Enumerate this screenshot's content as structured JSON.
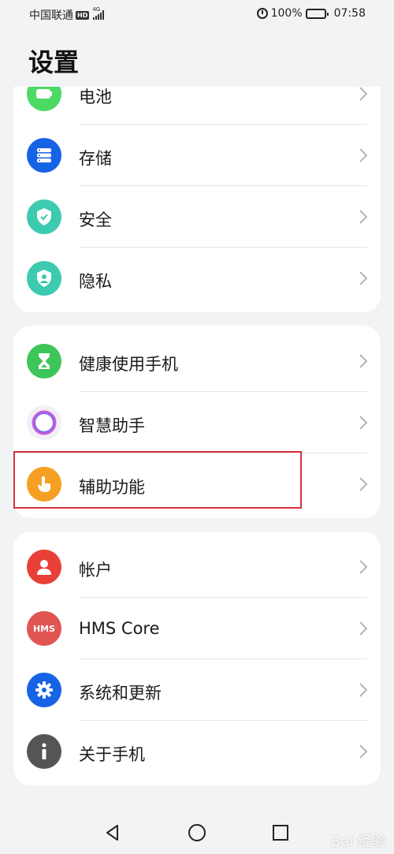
{
  "status_bar": {
    "carrier": "中国联通",
    "hd_badge": "HD",
    "network": "4G",
    "battery_percent": "100%",
    "time": "07:58"
  },
  "page_title": "设置",
  "groups": [
    {
      "items": [
        {
          "label": "电池",
          "icon": "battery-icon",
          "color": "#4cd964"
        },
        {
          "label": "存储",
          "icon": "storage-icon",
          "color": "#1763e6"
        },
        {
          "label": "安全",
          "icon": "shield-icon",
          "color": "#3ccab0"
        },
        {
          "label": "隐私",
          "icon": "privacy-icon",
          "color": "#3ccab0"
        }
      ]
    },
    {
      "items": [
        {
          "label": "健康使用手机",
          "icon": "hourglass-icon",
          "color": "#3dc55a"
        },
        {
          "label": "智慧助手",
          "icon": "assistant-ring-icon",
          "color": "#b56cf0"
        },
        {
          "label": "辅助功能",
          "icon": "hand-pointer-icon",
          "color": "#f5a023"
        }
      ]
    },
    {
      "items": [
        {
          "label": "帐户",
          "icon": "person-icon",
          "color": "#e84036"
        },
        {
          "label": "HMS Core",
          "icon": "hms-icon",
          "icon_text": "HMS",
          "color": "#e05452"
        },
        {
          "label": "系统和更新",
          "icon": "gear-icon",
          "color": "#1763e6"
        },
        {
          "label": "关于手机",
          "icon": "info-icon",
          "color": "#555555"
        }
      ]
    }
  ],
  "nav": {
    "back": "back-icon",
    "home": "home-icon",
    "recents": "recents-icon"
  },
  "watermark": "Bai 经验"
}
